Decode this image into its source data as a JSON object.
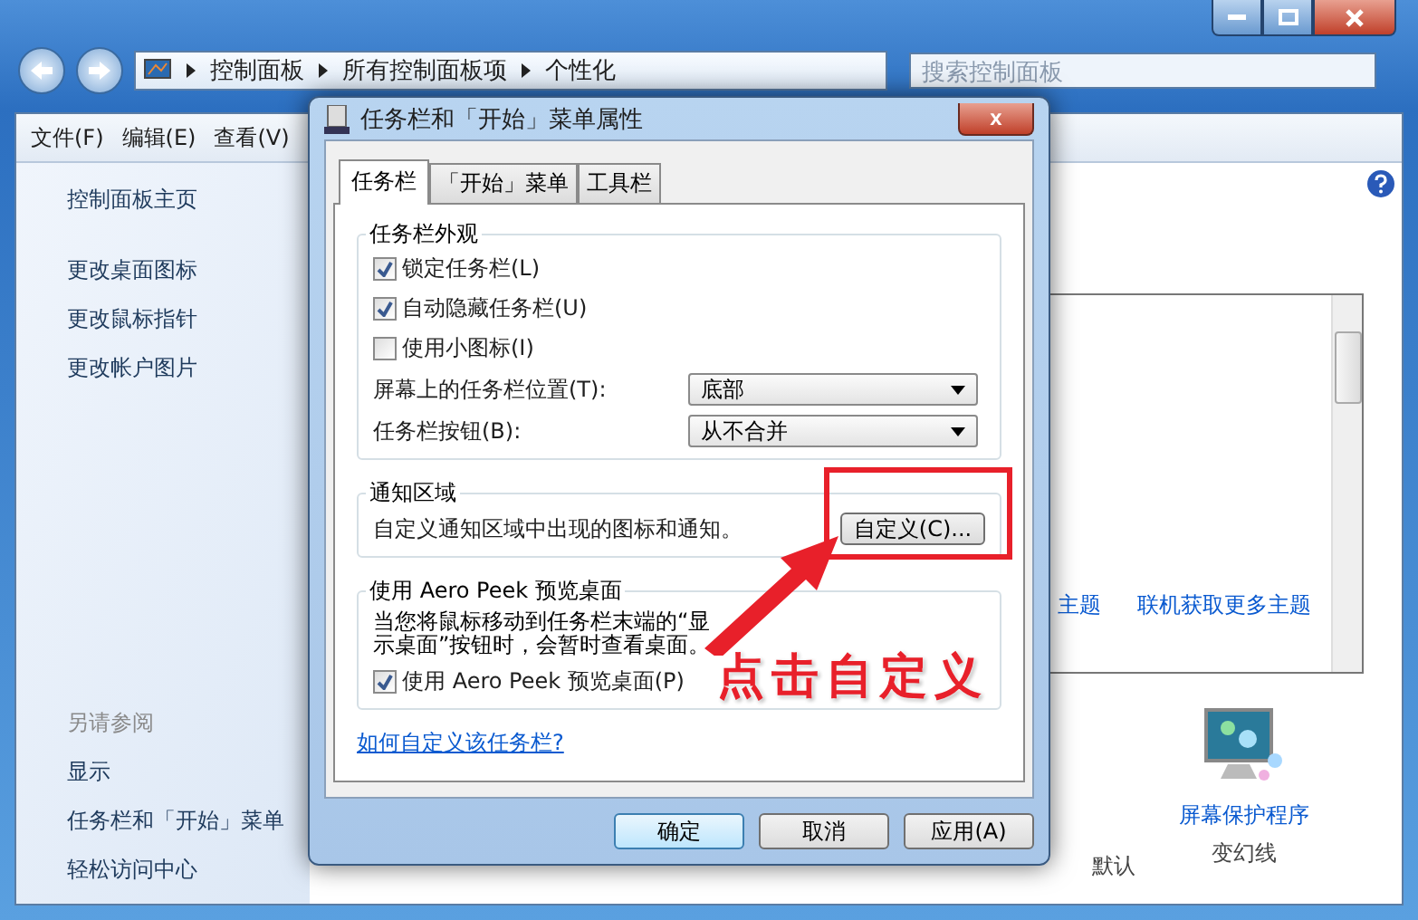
{
  "address_bar": {
    "segments": [
      "控制面板",
      "所有控制面板项",
      "个性化"
    ]
  },
  "search": {
    "placeholder": "搜索控制面板"
  },
  "menu": [
    "文件(F)",
    "编辑(E)",
    "查看(V)"
  ],
  "sidebar": {
    "links": [
      "控制面板主页",
      "更改桌面图标",
      "更改鼠标指针",
      "更改帐户图片"
    ],
    "see_also_title": "另请参阅",
    "see_also": [
      "显示",
      "任务栏和「开始」菜单",
      "轻松访问中心"
    ]
  },
  "themes": {
    "links": [
      "主题",
      "联机获取更多主题"
    ],
    "bottom_labels": [
      "默认"
    ]
  },
  "screensaver": {
    "title": "屏幕保护程序",
    "value": "变幻线"
  },
  "dialog": {
    "title": "任务栏和「开始」菜单属性",
    "close": "x",
    "tabs": [
      {
        "label": "任务栏",
        "selected": true
      },
      {
        "label": "「开始」菜单",
        "selected": false
      },
      {
        "label": "工具栏",
        "selected": false
      }
    ],
    "appearance": {
      "title": "任务栏外观",
      "checkboxes": [
        {
          "label": "锁定任务栏(L)",
          "checked": true
        },
        {
          "label": "自动隐藏任务栏(U)",
          "checked": true
        },
        {
          "label": "使用小图标(I)",
          "checked": false
        }
      ],
      "selects": [
        {
          "label": "屏幕上的任务栏位置(T):",
          "value": "底部"
        },
        {
          "label": "任务栏按钮(B):",
          "value": "从不合并"
        }
      ]
    },
    "notification": {
      "title": "通知区域",
      "text": "自定义通知区域中出现的图标和通知。",
      "button": "自定义(C)..."
    },
    "aero": {
      "title": "使用 Aero Peek 预览桌面",
      "text": "当您将鼠标移动到任务栏末端的“显示桌面”按钮时，会暂时查看桌面。",
      "checkbox": {
        "label": "使用 Aero Peek 预览桌面(P)",
        "checked": true
      }
    },
    "link": "如何自定义该任务栏?",
    "buttons": [
      {
        "label": "确定",
        "default": true
      },
      {
        "label": "取消",
        "default": false
      },
      {
        "label": "应用(A)",
        "default": false
      }
    ]
  },
  "annotation": {
    "text": "点击自定义"
  }
}
